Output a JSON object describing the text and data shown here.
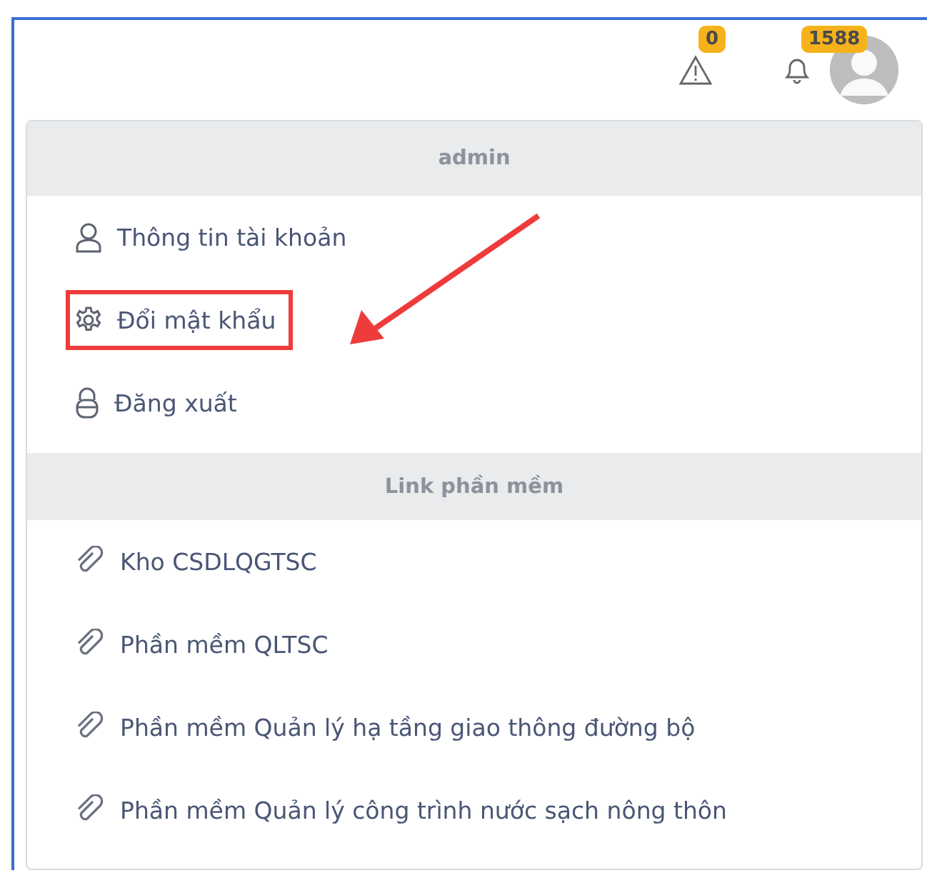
{
  "header": {
    "alerts": {
      "count": "0"
    },
    "notifications": {
      "count": "1588"
    }
  },
  "user_menu": {
    "sections": [
      {
        "title": "admin",
        "items": [
          {
            "kind": "user",
            "label": "Thông tin tài khoản",
            "highlighted": false
          },
          {
            "kind": "gear",
            "label": "Đổi mật khẩu",
            "highlighted": true
          },
          {
            "kind": "lock",
            "label": "Đăng xuất",
            "highlighted": false
          }
        ]
      },
      {
        "title": "Link phần mềm",
        "items": [
          {
            "kind": "link",
            "label": "Kho CSDLQGTSC",
            "highlighted": false
          },
          {
            "kind": "link",
            "label": "Phần mềm QLTSC",
            "highlighted": false
          },
          {
            "kind": "link",
            "label": "Phần mềm Quản lý hạ tầng giao thông đường bộ",
            "highlighted": false
          },
          {
            "kind": "link",
            "label": "Phần mềm Quản lý công trình nước sạch nông thôn",
            "highlighted": false
          }
        ]
      }
    ]
  }
}
